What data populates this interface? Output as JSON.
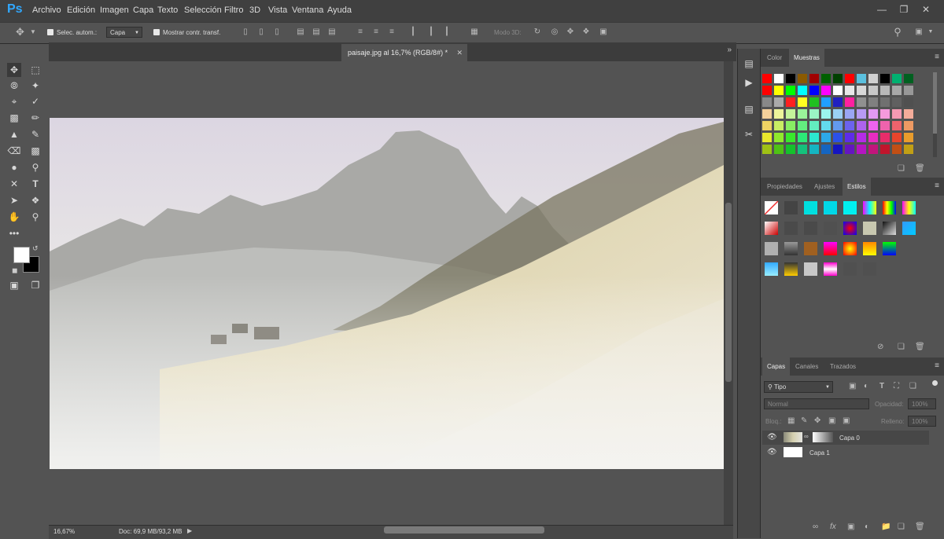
{
  "app": {
    "logo": "Ps"
  },
  "menu": [
    "Archivo",
    "Edición",
    "Imagen",
    "Capa",
    "Texto",
    "Selección",
    "Filtro",
    "3D",
    "Vista",
    "Ventana",
    "Ayuda"
  ],
  "options_bar": {
    "auto_select_label": "Selec. autom.:",
    "auto_select_value": "Capa",
    "show_transform_label": "Mostrar contr. transf.",
    "mode_3d_label": "Modo 3D:"
  },
  "document": {
    "tab_title": "paisaje.jpg al 16,7% (RGB/8#) *",
    "zoom": "16,67%",
    "doc_size": "Doc: 69,9 MB/93,2 MB"
  },
  "panels": {
    "color_tabs": [
      "Color",
      "Muestras"
    ],
    "props_tabs": [
      "Propiedades",
      "Ajustes",
      "Estilos"
    ],
    "layers_tabs": [
      "Capas",
      "Canales",
      "Trazados"
    ],
    "filter_kind": "Tipo",
    "blend_mode": "Normal",
    "opacity_label": "Opacidad:",
    "opacity_value": "100%",
    "lock_label": "Bloq.:",
    "fill_label": "Relleno:",
    "fill_value": "100%",
    "layers": [
      {
        "name": "Capa 0"
      },
      {
        "name": "Capa 1"
      }
    ]
  },
  "colors": {
    "foreground": "#ffffff",
    "background": "#000000"
  }
}
